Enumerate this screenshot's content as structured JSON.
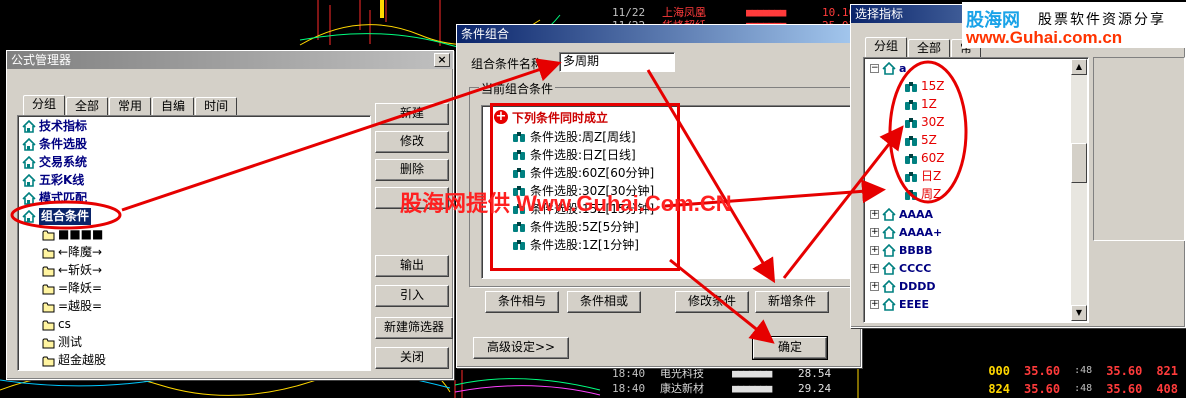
{
  "ticker_top": [
    {
      "time": "11/22",
      "name": "上海凤凰",
      "boxes": "■■■■■■■",
      "price": "10.10"
    },
    {
      "time": "11/22",
      "name": "华峰超纤",
      "boxes": "■■■■■■■",
      "price": "25.03"
    }
  ],
  "ticker_bottom": [
    {
      "time": "18:40",
      "name": "电光科技",
      "boxes": "■■■■■■■",
      "price": "28.54"
    },
    {
      "time": "18:40",
      "name": "康达新材",
      "boxes": "■■■■■■■",
      "price": "29.24"
    }
  ],
  "ticker_right": [
    {
      "qty": "000",
      "price": "35.60",
      "stamp": ":48",
      "price2": "35.60",
      "vol": "821"
    },
    {
      "qty": "824",
      "price": "35.60",
      "stamp": ":48",
      "price2": "35.60",
      "vol": "408"
    }
  ],
  "brand": {
    "name": "股海网",
    "slogan": "股票软件资源分享",
    "url": "www.Guhai.com.cn"
  },
  "watermark": "股海网提供 Www.Guhai.Com.CN",
  "formula_manager": {
    "title": "公式管理器",
    "close": "×",
    "tabs": [
      "分组",
      "全部",
      "常用",
      "自编",
      "时间"
    ],
    "tree": [
      {
        "label": "技术指标",
        "type": "house",
        "bold": true
      },
      {
        "label": "条件选股",
        "type": "house",
        "bold": true
      },
      {
        "label": "交易系统",
        "type": "house",
        "bold": true
      },
      {
        "label": "五彩K线",
        "type": "house",
        "bold": true
      },
      {
        "label": "模式匹配",
        "type": "house",
        "bold": true
      },
      {
        "label": "组合条件",
        "type": "house",
        "bold": true,
        "selected": true
      },
      {
        "label": "■■■■",
        "type": "folder"
      },
      {
        "label": "←降魔→",
        "type": "folder"
      },
      {
        "label": "←斩妖→",
        "type": "folder"
      },
      {
        "label": "=降妖=",
        "type": "folder"
      },
      {
        "label": "=越股=",
        "type": "folder"
      },
      {
        "label": "cs",
        "type": "folder"
      },
      {
        "label": "测试",
        "type": "folder"
      },
      {
        "label": "超金越股",
        "type": "folder"
      }
    ],
    "buttons": [
      "新建",
      "修改",
      "删除",
      "",
      "输出",
      "引入",
      "新建筛选器",
      "关闭"
    ]
  },
  "condition_combo": {
    "title": "条件组合",
    "name_label": "组合条件名称",
    "name_value": "多周期",
    "group_label": "当前组合条件",
    "root_label": "下列条件同时成立",
    "items": [
      "条件选股:周Z[周线]",
      "条件选股:日Z[日线]",
      "条件选股:60Z[60分钟]",
      "条件选股:30Z[30分钟]",
      "条件选股:15Z[15分钟]",
      "条件选股:5Z[5分钟]",
      "条件选股:1Z[1分钟]"
    ],
    "buttons": {
      "and": "条件相与",
      "or": "条件相或",
      "edit": "修改条件",
      "add": "新增条件",
      "advanced": "高级设定>>",
      "ok": "确定"
    }
  },
  "select_indicator": {
    "title": "选择指标",
    "tabs": [
      "分组",
      "全部",
      "常"
    ],
    "tree": [
      {
        "label": "a",
        "type": "house",
        "expanded": true
      },
      {
        "label": "15Z",
        "type": "binoc",
        "red": true
      },
      {
        "label": "1Z",
        "type": "binoc",
        "red": true
      },
      {
        "label": "30Z",
        "type": "binoc",
        "red": true
      },
      {
        "label": "5Z",
        "type": "binoc",
        "red": true
      },
      {
        "label": "60Z",
        "type": "binoc",
        "red": true
      },
      {
        "label": "日Z",
        "type": "binoc",
        "red": true
      },
      {
        "label": "周Z",
        "type": "binoc",
        "red": true
      },
      {
        "label": "AAAA",
        "type": "house"
      },
      {
        "label": "AAAA+",
        "type": "house"
      },
      {
        "label": "BBBB",
        "type": "house"
      },
      {
        "label": "CCCC",
        "type": "house"
      },
      {
        "label": "DDDD",
        "type": "house"
      },
      {
        "label": "EEEE",
        "type": "house"
      }
    ]
  },
  "colors": {
    "accent_red": "#e60000",
    "title_active": "#0a246a",
    "tree_bold": "#000080"
  }
}
